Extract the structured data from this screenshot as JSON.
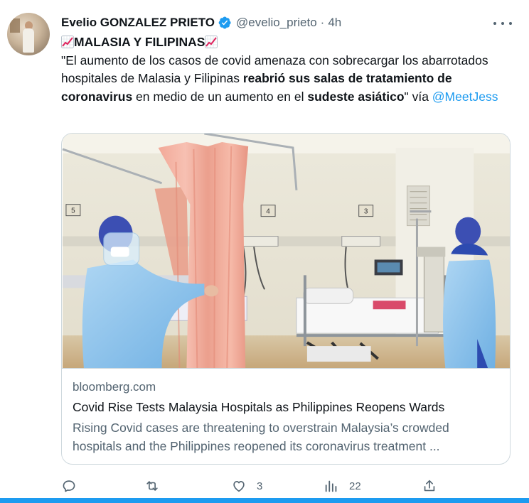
{
  "author": {
    "name": "Evelio GONZALEZ PRIETO",
    "handle": "@evelio_prieto",
    "separator": "·",
    "time": "4h"
  },
  "tweet": {
    "headline": "MALASIA Y FILIPINAS",
    "p1": "\"El aumento de los casos de covid amenaza con sobrecargar los abarrotados hospitales de Malasia y Filipinas ",
    "b1": "reabrió sus salas de tratamiento de coronavirus",
    "p2": " en medio de un aumento en el ",
    "b2": "sudeste asiático",
    "p3": "\" vía ",
    "mention": "@MeetJess"
  },
  "card": {
    "domain": "bloomberg.com",
    "title": "Covid Rise Tests Malaysia Hospitals as Philippines Reopens Wards",
    "description": "Rising Covid cases are threatening to overstrain Malaysia’s crowded hospitals and the Philippines reopened its coronavirus treatment ...",
    "bed_numbers": [
      "5",
      "4",
      "3"
    ]
  },
  "actions": {
    "reply": "",
    "retweet": "",
    "like": "3",
    "views": "22"
  },
  "colors": {
    "accent": "#1d9bf0",
    "text": "#0f1419",
    "secondary": "#536471"
  },
  "icons": [
    "verified-badge-icon",
    "chart-increasing-icon",
    "more-icon",
    "reply-icon",
    "retweet-icon",
    "like-icon",
    "views-icon",
    "share-icon"
  ]
}
